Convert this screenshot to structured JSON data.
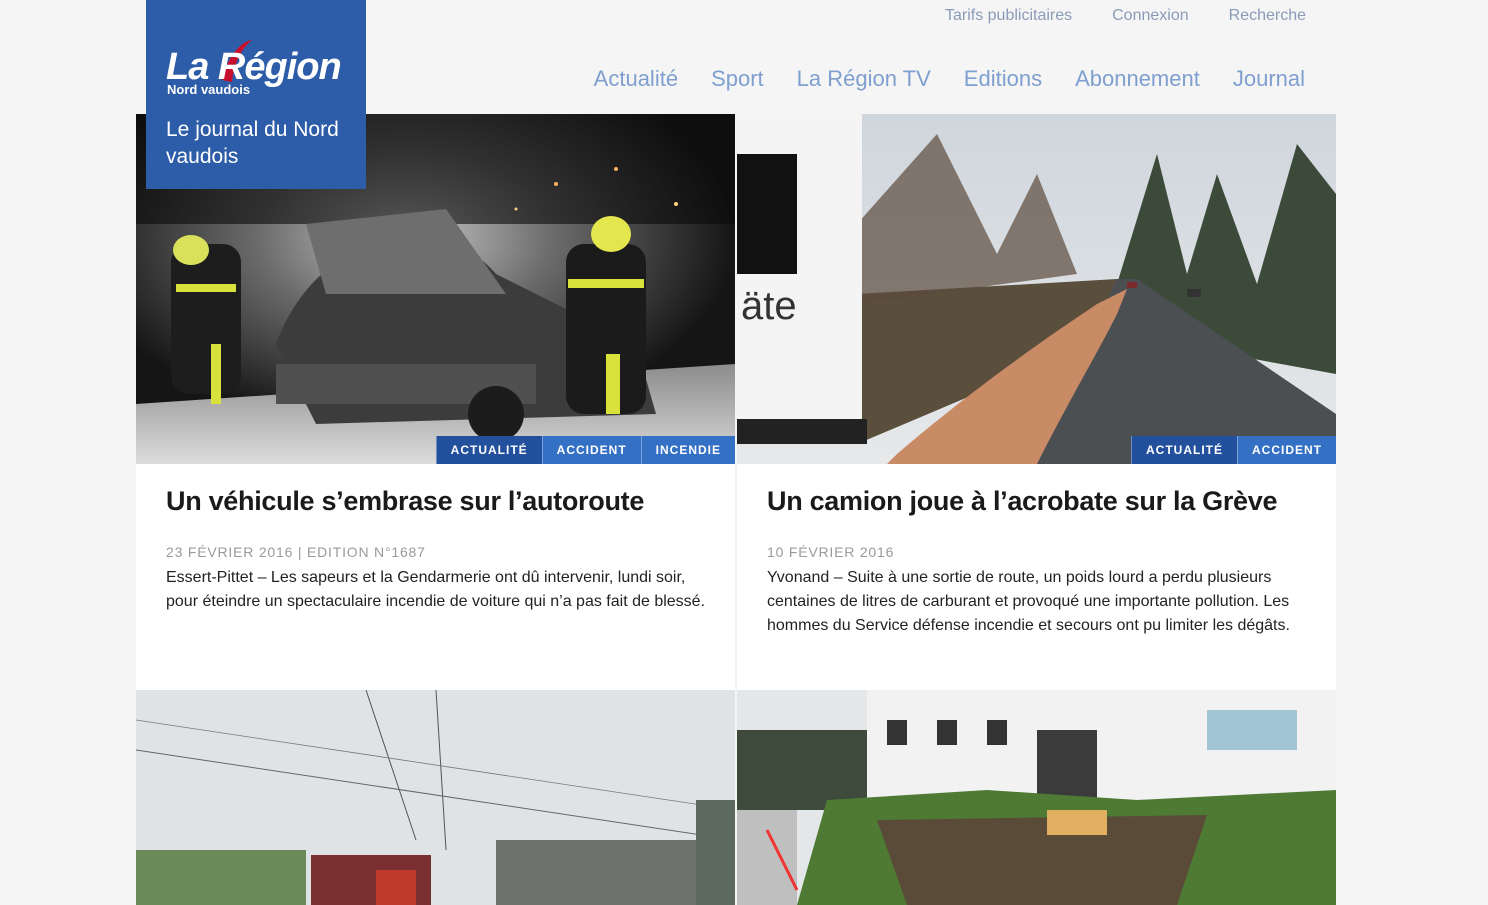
{
  "brand": {
    "title": "La Région",
    "subtitle": "Nord vaudois",
    "tagline": "Le journal du Nord vaudois",
    "color": "#2d5ca8",
    "accent": "#c8102e"
  },
  "util_nav": [
    "Tarifs publicitaires",
    "Connexion",
    "Recherche"
  ],
  "main_nav": [
    "Actualité",
    "Sport",
    "La Région TV",
    "Editions",
    "Abonnement",
    "Journal"
  ],
  "articles": [
    {
      "tags": [
        "ACTUALITÉ",
        "ACCIDENT",
        "INCENDIE"
      ],
      "title": "Un véhicule s’embrase sur l’autoroute",
      "meta": "23 FÉVRIER 2016 | EDITION N°1687",
      "text": "Essert-Pittet – Les sapeurs et la Gendarmerie ont dû intervenir, lundi soir, pour éteindre un spectaculaire incendie de voiture qui n’a pas fait de blessé.",
      "image": "burning-car-photo"
    },
    {
      "tags": [
        "ACTUALITÉ",
        "ACCIDENT"
      ],
      "title": "Un camion joue à l’acrobate sur la Grève",
      "meta": "10 FÉVRIER 2016",
      "text": "Yvonand – Suite à une sortie de route, un poids lourd a perdu plusieurs centaines de litres de carburant et provoqué une importante pollution. Les hommes du Service défense incendie et secours ont pu limiter les dégâts.",
      "image": "road-spill-photo"
    },
    {
      "image": "train-derailment-photo"
    },
    {
      "image": "landslide-building-photo"
    }
  ]
}
